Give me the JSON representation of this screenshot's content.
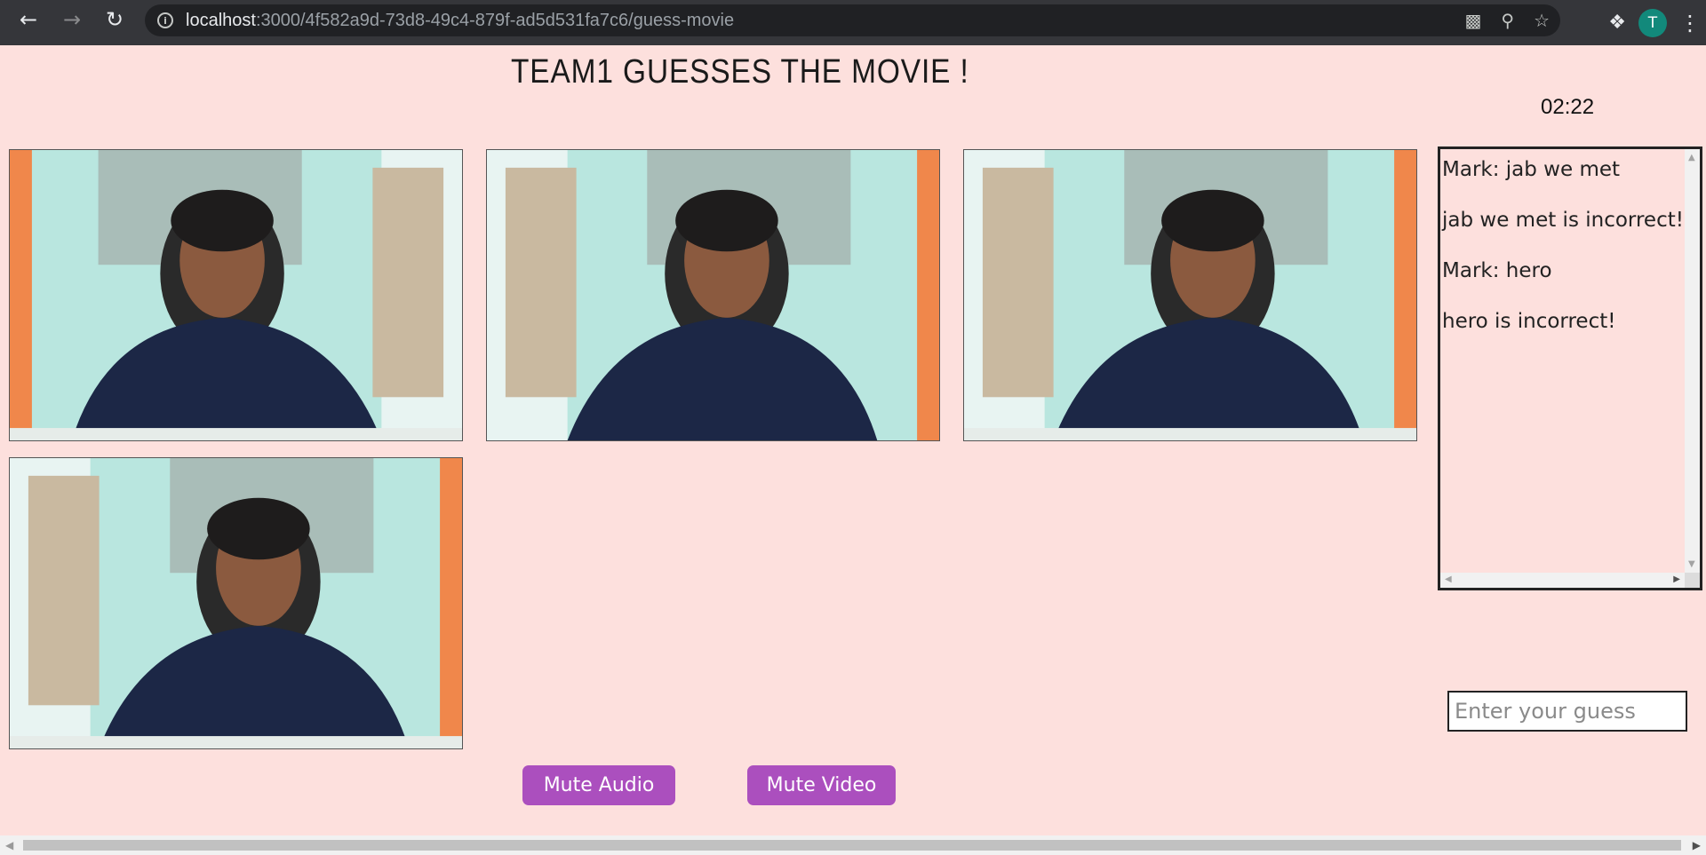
{
  "browser": {
    "url_host": "localhost",
    "url_rest": ":3000/4f582a9d-73d8-49c4-879f-ad5d531fa7c6/guess-movie",
    "profile_initial": "T"
  },
  "page": {
    "title": "TEAM1 GUESSES THE MOVIE !",
    "timer": "02:22",
    "chat_messages": [
      "Mark: jab we met",
      "jab we met is incorrect!",
      "Mark: hero",
      "hero is incorrect!"
    ],
    "guess_placeholder": "Enter your guess",
    "mute_audio_label": "Mute Audio",
    "mute_video_label": "Mute Video"
  },
  "colors": {
    "page_background": "#fde0dd",
    "button": "#ab4fbe",
    "avatar": "#12897b"
  }
}
